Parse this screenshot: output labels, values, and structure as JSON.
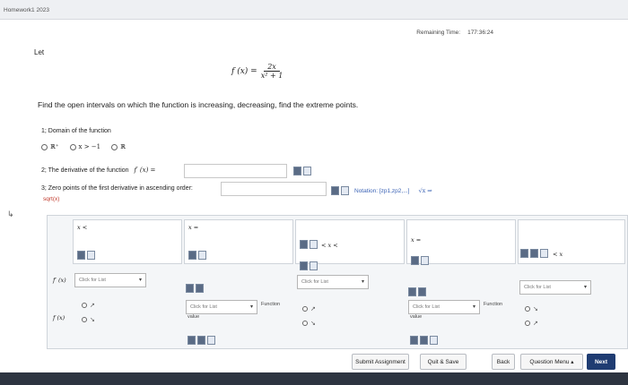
{
  "window": {
    "tab": "Homework1 2023"
  },
  "timer": {
    "label": "Remaining Time:",
    "value": "177:36:24"
  },
  "intro": "Let",
  "function": {
    "lhs": "f (x) =",
    "numerator": "2x",
    "denominator": "x² + 1"
  },
  "instruction": "Find the open intervals on which the function is increasing, decreasing, find the extreme points.",
  "q1": {
    "label": "1; Domain of the function",
    "options": [
      "ℝ⁺",
      "x > −1",
      "ℝ"
    ]
  },
  "q2": {
    "label": "2; The derivative of the function",
    "expr": "f′ (x) ="
  },
  "q3": {
    "label": "3; Zero points of the first derivative in ascending order:",
    "hint": "sqrt(x)"
  },
  "notation": {
    "label": "Notation: [zp1,zp2,...]",
    "sym": "√x ⇒"
  },
  "grid": {
    "headers": [
      "x <",
      "x =",
      "< x <",
      "x =",
      "< x"
    ],
    "row_labels": [
      "f′ (x)",
      "f (x)"
    ],
    "dropdown_placeholder": "Click for List",
    "value_label": "value",
    "function_label": "Function",
    "arrows": [
      "↗",
      "↘"
    ]
  },
  "footer": {
    "submit": "Submit Assignment",
    "quit": "Quit & Save",
    "back": "Back",
    "menu": "Question Menu ▴",
    "next": "Next"
  }
}
